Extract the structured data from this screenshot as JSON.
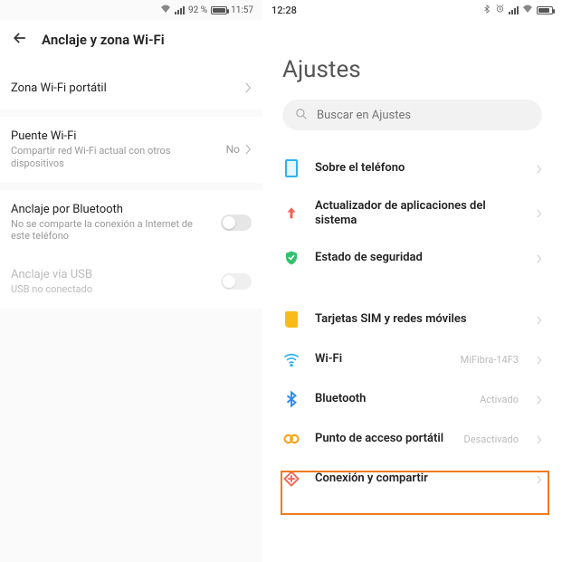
{
  "left": {
    "status": {
      "battery_pct": "92 %",
      "time": "11:57",
      "battery_fill_pct": 92
    },
    "header_title": "Anclaje y zona Wi-Fi",
    "rows": {
      "portable_wifi": {
        "title": "Zona Wi-Fi portátil"
      },
      "wifi_bridge": {
        "title": "Puente Wi-Fi",
        "sub": "Compartir red Wi-Fi actual con otros dispositivos",
        "value": "No"
      },
      "bt_tether": {
        "title": "Anclaje por Bluetooth",
        "sub": "No se comparte la conexión a Internet de este teléfono"
      },
      "usb_tether": {
        "title": "Anclaje vía USB",
        "sub": "USB no conectado"
      }
    }
  },
  "right": {
    "status": {
      "time": "12:28"
    },
    "title": "Ajustes",
    "search_placeholder": "Buscar en Ajustes",
    "items": {
      "about": {
        "label": "Sobre el teléfono"
      },
      "updater": {
        "label": "Actualizador de aplicaciones del sistema"
      },
      "security": {
        "label": "Estado de seguridad"
      },
      "sim": {
        "label": "Tarjetas SIM y redes móviles"
      },
      "wifi": {
        "label": "Wi-Fi",
        "value": "MiFibra-14F3"
      },
      "bt": {
        "label": "Bluetooth",
        "value": "Activado"
      },
      "hotspot": {
        "label": "Punto de acceso portátil",
        "value": "Desactivado"
      },
      "share": {
        "label": "Conexión y compartir"
      }
    }
  }
}
